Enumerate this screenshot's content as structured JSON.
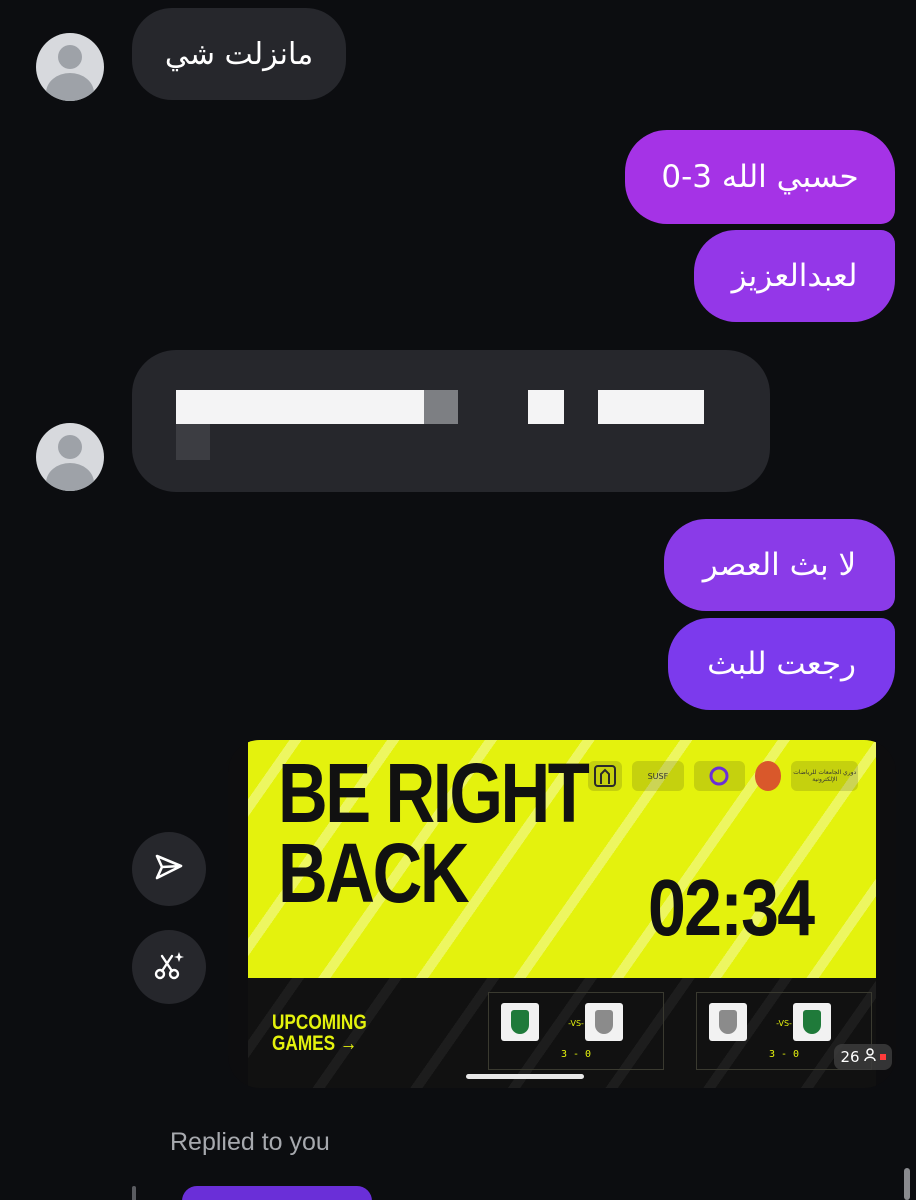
{
  "messages": [
    {
      "text": "مانزلت شي"
    },
    {
      "text": "حسبي الله 3-0"
    },
    {
      "text": "لعبدالعزيز"
    },
    {
      "text": "لا بث العصر"
    },
    {
      "text": "رجعت للبث"
    }
  ],
  "media": {
    "title_line1": "BE RIGHT",
    "title_line2": "BACK",
    "timer": "02:34",
    "upcoming_line1": "UPCOMING",
    "upcoming_line2": "GAMES →",
    "vs_label": "-VS-",
    "match1_score": "3 - 0",
    "match2_score": "3 - 0",
    "sponsor_text": "دوري الجامعات للرياضات الإلكترونية",
    "viewer_count": "26"
  },
  "icons": {
    "send": "send-icon",
    "remix": "scissors-sparkle-icon",
    "person": "person-icon"
  },
  "replied_label": "Replied to you",
  "colors": {
    "background": "#0c0d10",
    "incoming_bubble": "#26272c",
    "outgoing_top": "#a533e6",
    "outgoing_bottom": "#7c3aed",
    "banner_yellow": "#e4f20d"
  }
}
